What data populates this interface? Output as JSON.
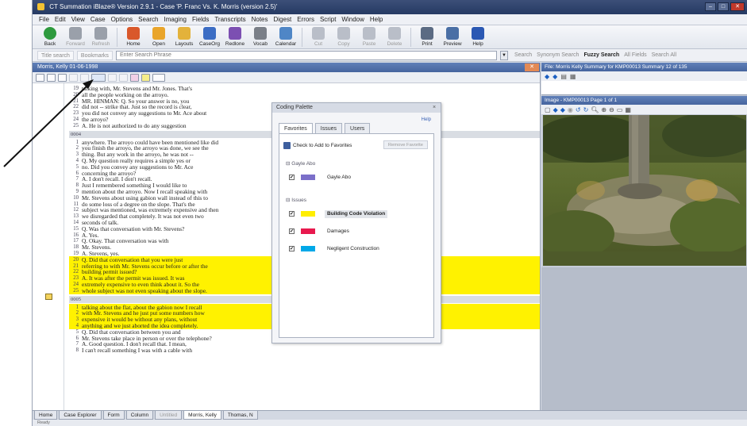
{
  "window": {
    "title": "CT Summation iBlaze® Version 2.9.1 - Case 'P. Franc Vs. K. Morris (version 2.5)'",
    "buttons": [
      "–",
      "□",
      "✕"
    ]
  },
  "menu": [
    "File",
    "Edit",
    "View",
    "Case",
    "Options",
    "Search",
    "Imaging",
    "Fields",
    "Transcripts",
    "Notes",
    "Digest",
    "Errors",
    "Script",
    "Window",
    "Help"
  ],
  "toolbar": [
    {
      "label": "Back",
      "icon": "back-icon",
      "color": "#2e9a3e",
      "enabled": true
    },
    {
      "label": "Forward",
      "icon": "forward-icon",
      "color": "#9aa0aa",
      "enabled": false
    },
    {
      "label": "Refresh",
      "icon": "refresh-icon",
      "color": "#9aa0aa",
      "enabled": false
    },
    {
      "label": "Home",
      "icon": "home-icon",
      "color": "#d9582b",
      "enabled": true
    },
    {
      "label": "Open",
      "icon": "folder-icon",
      "color": "#e9a52b",
      "enabled": true
    },
    {
      "label": "Layouts",
      "icon": "layouts-icon",
      "color": "#e3b23b",
      "enabled": true
    },
    {
      "label": "CaseOrg",
      "icon": "caseorg-icon",
      "color": "#3c6dc4",
      "enabled": true
    },
    {
      "label": "Redlone",
      "icon": "redlone-icon",
      "color": "#7c4fb2",
      "enabled": true
    },
    {
      "label": "Vocab",
      "icon": "vocab-icon",
      "color": "#7a7f88",
      "enabled": true
    },
    {
      "label": "Calendar",
      "icon": "calendar-icon",
      "color": "#4f86c6",
      "enabled": true
    },
    {
      "label": "Cut",
      "icon": "cut-icon",
      "color": "#b9bec8",
      "enabled": false
    },
    {
      "label": "Copy",
      "icon": "copy-icon",
      "color": "#b9bec8",
      "enabled": false
    },
    {
      "label": "Paste",
      "icon": "paste-icon",
      "color": "#b9bec8",
      "enabled": false
    },
    {
      "label": "Delete",
      "icon": "delete-icon",
      "color": "#b9bec8",
      "enabled": false
    },
    {
      "label": "Print",
      "icon": "print-icon",
      "color": "#5b6b83",
      "enabled": true
    },
    {
      "label": "Preview",
      "icon": "preview-icon",
      "color": "#4a6fa5",
      "enabled": true
    },
    {
      "label": "Help",
      "icon": "help-icon",
      "color": "#2b58b3",
      "enabled": true
    }
  ],
  "searchbar": {
    "left_chips": [
      "Title search",
      "Bookmarks"
    ],
    "placeholder": "Enter Search Phrase",
    "right_items": [
      "Search",
      "Synonym Search",
      "Fuzzy Search",
      "All Fields",
      "Search All"
    ]
  },
  "transcript": {
    "header": "Morris, Kelly 01-06-1998",
    "close_label": "✕",
    "page_markers": [
      "0004",
      "0005"
    ],
    "lines": [
      {
        "n": "19",
        "t": "talking with, Mr. Stevens and Mr. Jones.  That's"
      },
      {
        "n": "20",
        "t": "all the people working on the arroyo."
      },
      {
        "n": "21",
        "t": "        MR. HINMAN:  Q.  So your answer is no, you"
      },
      {
        "n": "22",
        "t": "did not -- strike that.  Just so the record is clear,"
      },
      {
        "n": "23",
        "t": "you did not convey any suggestions to Mr. Ace about"
      },
      {
        "n": "24",
        "t": "the arroyo?"
      },
      {
        "n": "25",
        "t": "     A.    He is not authorized to do any suggestion"
      },
      {
        "n": "1",
        "t": "anywhere.  The arroyo could have been mentioned like did"
      },
      {
        "n": "2",
        "t": "you finish the arroyo, the arroyo was done, we see the"
      },
      {
        "n": "3",
        "t": "thing.  But any work in the arroyo, he was not --"
      },
      {
        "n": "4",
        "t": "     Q.    My question really requires a simple yes or"
      },
      {
        "n": "5",
        "t": "no.  Did you convey any suggestions to Mr. Ace"
      },
      {
        "n": "6",
        "t": "concerning the arroyo?"
      },
      {
        "n": "7",
        "t": "     A.    I don't recall.  I don't recall."
      },
      {
        "n": "8",
        "t": "               Just I remembered something I would like to"
      },
      {
        "n": "9",
        "t": "mention about the arroyo.  Now I recall speaking with"
      },
      {
        "n": "10",
        "t": "Mr. Stevens about using gabion wall instead of this to"
      },
      {
        "n": "11",
        "t": "do some loss of a degree on the slope.  That's the"
      },
      {
        "n": "12",
        "t": "subject was mentioned, was extremely expensive and then"
      },
      {
        "n": "13",
        "t": "we disregarded that completely.  It was not even two"
      },
      {
        "n": "14",
        "t": "seconds of talk."
      },
      {
        "n": "15",
        "t": "     Q.    Was that conversation with Mr. Stevens?"
      },
      {
        "n": "16",
        "t": "     A.    Yes."
      },
      {
        "n": "17",
        "t": "     Q.    Okay.  That conversation was with"
      },
      {
        "n": "18",
        "t": "Mr. Stevens."
      },
      {
        "n": "19",
        "t": "     A.    Stevens, yes."
      },
      {
        "n": "20",
        "t": "     Q.    Did that conversation that you were just"
      },
      {
        "n": "21",
        "t": "referring to with Mr. Stevens occur before or after the"
      },
      {
        "n": "22",
        "t": "building permit issued?"
      },
      {
        "n": "23",
        "t": "     A.    It was after the permit was issued.  It was"
      },
      {
        "n": "24",
        "t": "extremely expensive to even think about it.  So the"
      },
      {
        "n": "25",
        "t": "whole subject was not even speaking about the slope."
      },
      {
        "n": "1",
        "t": "talking about the flat, about the gabion now I recall"
      },
      {
        "n": "2",
        "t": "with Mr. Stevens and he just put some numbers how"
      },
      {
        "n": "3",
        "t": "expensive it would be without any plans, without"
      },
      {
        "n": "4",
        "t": "anything and we just aborted the idea completely."
      },
      {
        "n": "5",
        "t": "     Q.    Did that conversation between you and"
      },
      {
        "n": "6",
        "t": "Mr. Stevens take place in person or over the telephone?"
      },
      {
        "n": "7",
        "t": "     A.    Good question.  I don't recall that.  I mean,"
      },
      {
        "n": "8",
        "t": "I can't recall something I was with a cable with"
      }
    ]
  },
  "palette": {
    "title": "Coding Palette",
    "help": "Help",
    "tabs": [
      "Favorites",
      "Issues",
      "Users"
    ],
    "check_label": "Check to Add to Favorites",
    "favorites_button": "Remove Favorite",
    "groups": [
      {
        "name": "Gayle Abo",
        "items": [
          {
            "label": "Gayle Abo",
            "color": "#7b6fc9",
            "checked": true,
            "selected": false
          }
        ]
      },
      {
        "name": "Issues",
        "items": [
          {
            "label": "Building Code Violation",
            "color": "#ffee00",
            "checked": true,
            "selected": true
          },
          {
            "label": "Damages",
            "color": "#e8194e",
            "checked": true,
            "selected": false
          },
          {
            "label": "Negligent Construction",
            "color": "#00a8e8",
            "checked": true,
            "selected": false
          }
        ]
      }
    ]
  },
  "summary": {
    "header": "File: Morris Kelly Summary for KMP00013  Summary 12 of 135"
  },
  "image_viewer": {
    "header": "Image - KMP00013  Page 1 of 1"
  },
  "bottom_tabs": [
    {
      "label": "Home",
      "active": false,
      "dim": false
    },
    {
      "label": "Case Explorer",
      "active": false,
      "dim": false
    },
    {
      "label": "Form",
      "active": false,
      "dim": false
    },
    {
      "label": "Column",
      "active": false,
      "dim": false
    },
    {
      "label": "Untitled",
      "active": false,
      "dim": true
    },
    {
      "label": "Morris, Kelly",
      "active": true,
      "dim": false
    },
    {
      "label": "Thomas, N",
      "active": false,
      "dim": false
    }
  ],
  "status": "Ready",
  "colors": {
    "highlight": "#fff200",
    "title_bar": "#2d4270",
    "pane_header": "#5677b0"
  }
}
